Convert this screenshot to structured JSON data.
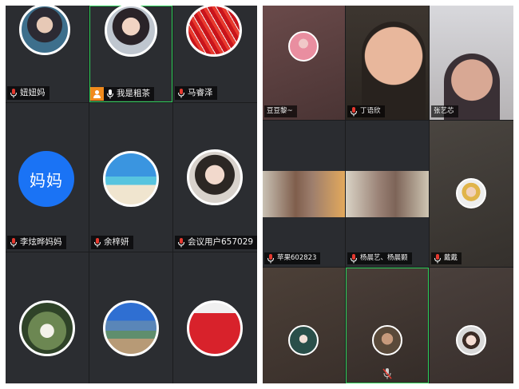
{
  "left": {
    "tiles": [
      {
        "name": "妞妞妈"
      },
      {
        "name": "我是粗茶"
      },
      {
        "name": "马睿泽"
      },
      {
        "name": "李炫晔妈妈",
        "initials": "妈妈"
      },
      {
        "name": "余梓妍"
      },
      {
        "name": "会议用户657029"
      },
      {
        "name": ""
      },
      {
        "name": ""
      },
      {
        "name": ""
      }
    ]
  },
  "right": {
    "tiles": [
      {
        "name": "豆豆黎~"
      },
      {
        "name": "丁语欣"
      },
      {
        "name": "张艺芯"
      },
      {
        "name": "苹果602823"
      },
      {
        "name": "杨晨艺、杨晨颢"
      },
      {
        "name": "戴戴"
      },
      {
        "name": ""
      },
      {
        "name": ""
      },
      {
        "name": ""
      }
    ]
  },
  "icons": {
    "mic": "microphone-icon",
    "host": "host-person-icon",
    "muted": "mic-muted-icon"
  },
  "colors": {
    "active_border": "#2fcf5a",
    "initials_bg": "#1a73f5",
    "host_badge": "#f08a1c",
    "mic_red": "#e5392f"
  }
}
